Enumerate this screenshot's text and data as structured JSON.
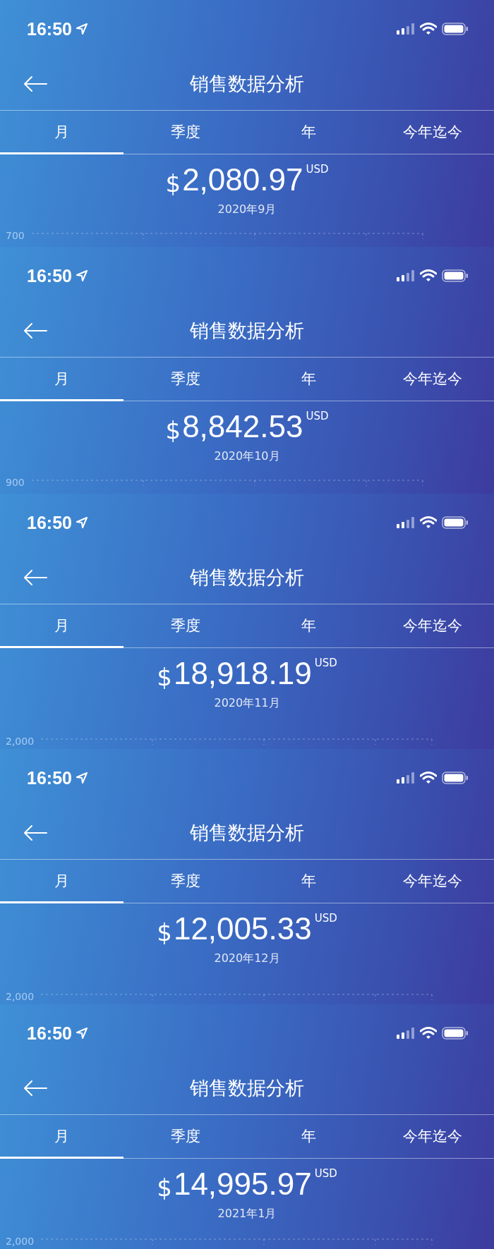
{
  "screens": [
    {
      "status_time": "16:50",
      "title": "销售数据分析",
      "tabs": [
        {
          "label": "月",
          "selected": true
        },
        {
          "label": "季度",
          "selected": false
        },
        {
          "label": "年",
          "selected": false
        },
        {
          "label": "今年迄今",
          "selected": false
        }
      ],
      "currency_symbol": "$",
      "amount": "2,080.97",
      "currency": "USD",
      "period": "2020年9月",
      "axis_label": "700"
    },
    {
      "status_time": "16:50",
      "title": "销售数据分析",
      "tabs": [
        {
          "label": "月",
          "selected": true
        },
        {
          "label": "季度",
          "selected": false
        },
        {
          "label": "年",
          "selected": false
        },
        {
          "label": "今年迄今",
          "selected": false
        }
      ],
      "currency_symbol": "$",
      "amount": "8,842.53",
      "currency": "USD",
      "period": "2020年10月",
      "axis_label": "900"
    },
    {
      "status_time": "16:50",
      "title": "销售数据分析",
      "tabs": [
        {
          "label": "月",
          "selected": true
        },
        {
          "label": "季度",
          "selected": false
        },
        {
          "label": "年",
          "selected": false
        },
        {
          "label": "今年迄今",
          "selected": false
        }
      ],
      "currency_symbol": "$",
      "amount": "18,918.19",
      "currency": "USD",
      "period": "2020年11月",
      "axis_label": "2,000"
    },
    {
      "status_time": "16:50",
      "title": "销售数据分析",
      "tabs": [
        {
          "label": "月",
          "selected": true
        },
        {
          "label": "季度",
          "selected": false
        },
        {
          "label": "年",
          "selected": false
        },
        {
          "label": "今年迄今",
          "selected": false
        }
      ],
      "currency_symbol": "$",
      "amount": "12,005.33",
      "currency": "USD",
      "period": "2020年12月",
      "axis_label": "2,000"
    },
    {
      "status_time": "16:50",
      "title": "销售数据分析",
      "tabs": [
        {
          "label": "月",
          "selected": true
        },
        {
          "label": "季度",
          "selected": false
        },
        {
          "label": "年",
          "selected": false
        },
        {
          "label": "今年迄今",
          "selected": false
        }
      ],
      "currency_symbol": "$",
      "amount": "14,995.97",
      "currency": "USD",
      "period": "2021年1月",
      "axis_label": "2,000"
    }
  ]
}
